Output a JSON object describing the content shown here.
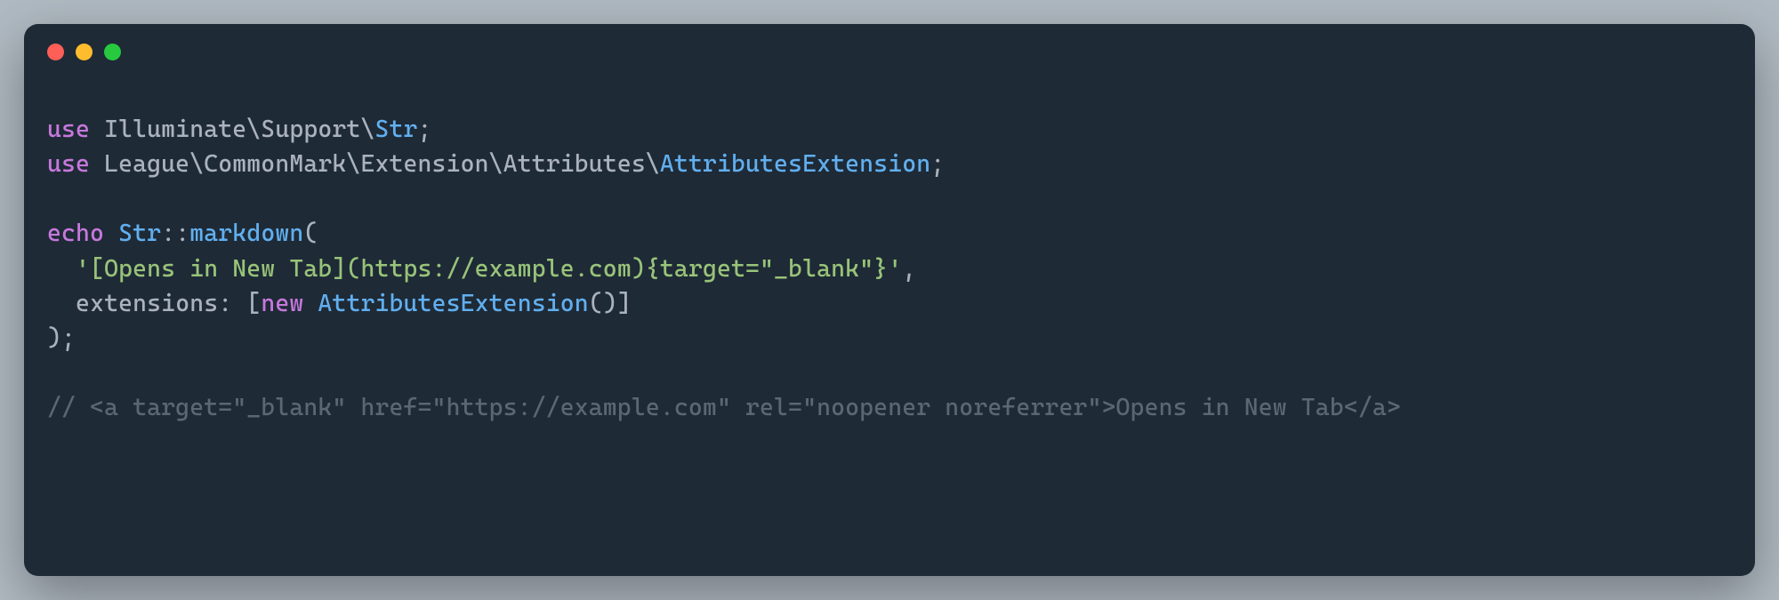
{
  "window": {
    "traffic_lights": [
      "red",
      "yellow",
      "green"
    ]
  },
  "code": {
    "line1": {
      "kw": "use",
      "ns": " Illuminate\\Support\\",
      "cls": "Str",
      "end": ";"
    },
    "line2": {
      "kw": "use",
      "ns": " League\\CommonMark\\Extension\\Attributes\\",
      "cls": "AttributesExtension",
      "end": ";"
    },
    "line4": {
      "kw": "echo",
      "sp": " ",
      "cls": "Str",
      "op": "::",
      "fn": "markdown",
      "open": "("
    },
    "line5": {
      "indent": "  ",
      "str": "'[Opens in New Tab](https://example.com){target=\"_blank\"}'",
      "comma": ","
    },
    "line6": {
      "indent": "  ",
      "named": "extensions",
      "colon": ": [",
      "kw": "new",
      "sp": " ",
      "cls": "AttributesExtension",
      "parens": "()",
      "close": "]"
    },
    "line7": {
      "close": ");"
    },
    "line9": {
      "comment": "// <a target=\"_blank\" href=\"https://example.com\" rel=\"noopener noreferrer\">Opens in New Tab</a>"
    }
  }
}
